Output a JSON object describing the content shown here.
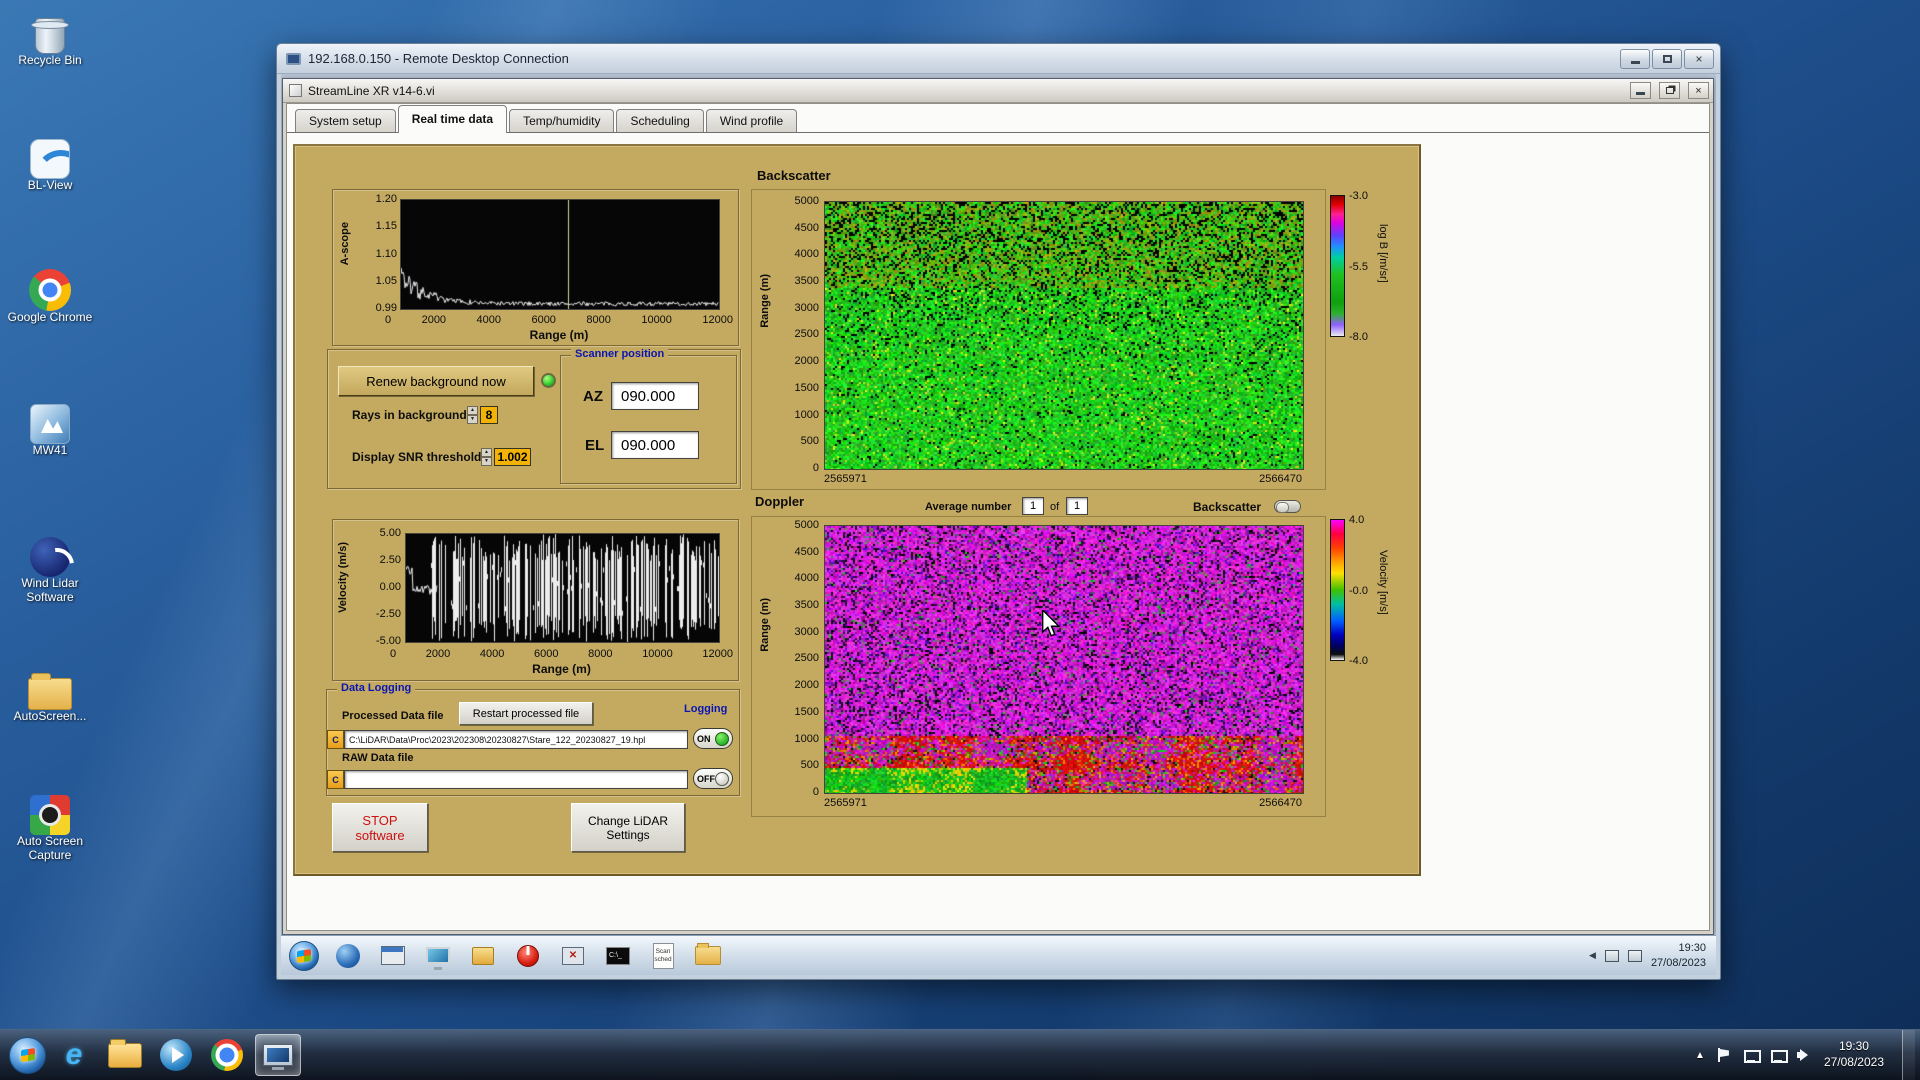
{
  "desktop": {
    "icons": [
      {
        "label": "Recycle Bin"
      },
      {
        "label": "BL-View"
      },
      {
        "label": "Google Chrome"
      },
      {
        "label": "MW41"
      },
      {
        "label": "Wind Lidar Software"
      },
      {
        "label": "AutoScreen..."
      },
      {
        "label": "Auto Screen Capture"
      }
    ]
  },
  "rdp_window": {
    "title": "192.168.0.150 - Remote Desktop Connection"
  },
  "app_window": {
    "title": "StreamLine XR v14-6.vi",
    "tabs": [
      "System setup",
      "Real time data",
      "Temp/humidity",
      "Scheduling",
      "Wind profile"
    ]
  },
  "controls": {
    "renew_button": "Renew background now",
    "rays_label": "Rays in background",
    "rays_value": "8",
    "snr_label": "Display SNR threshold",
    "snr_value": "1.002",
    "scanner": {
      "title": "Scanner position",
      "az_label": "AZ",
      "az_value": "090.000",
      "el_label": "EL",
      "el_value": "090.000"
    },
    "average_label": "Average number",
    "average_value": "1",
    "average_of": "of",
    "average_count": "1",
    "backscatter_toggle_label": "Backscatter"
  },
  "logging": {
    "group_title": "Data Logging",
    "processed_label": "Processed Data file",
    "restart_button": "Restart processed file",
    "logging_label": "Logging",
    "drive_label": "C",
    "processed_path": "C:\\LiDAR\\Data\\Proc\\2023\\202308\\20230827\\Stare_122_20230827_19.hpl",
    "raw_label": "RAW Data file",
    "raw_path": "",
    "on_label": "ON",
    "off_label": "OFF"
  },
  "actions": {
    "stop_line1": "STOP",
    "stop_line2": "software",
    "change_line1": "Change LiDAR",
    "change_line2": "Settings"
  },
  "session_taskbar": {
    "scan_icon_label": "Scan sched",
    "clock_time": "19:30",
    "clock_date": "27/08/2023"
  },
  "host_taskbar": {
    "clock_time": "19:30",
    "clock_date": "27/08/2023"
  },
  "chart_data": [
    {
      "id": "ascope",
      "type": "line",
      "xlabel": "Range (m)",
      "ylabel": "A-scope",
      "xlim": [
        0,
        12000
      ],
      "ylim": [
        0.99,
        1.2
      ],
      "xticks": [
        "0",
        "2000",
        "4000",
        "6000",
        "8000",
        "10000",
        "12000"
      ],
      "yticks": [
        "1.20",
        "1.15",
        "1.10",
        "1.05",
        "0.99"
      ],
      "cursor_x": 6300,
      "series": [
        {
          "name": "a-scope background",
          "x": [
            0,
            200,
            400,
            800,
            1200,
            2000,
            3000,
            4000,
            6000,
            8000,
            10000,
            12000
          ],
          "y": [
            1.005,
            1.06,
            1.05,
            1.035,
            1.02,
            1.01,
            1.005,
            1.002,
            1.0,
            1.0,
            1.0,
            1.0
          ]
        }
      ]
    },
    {
      "id": "backscatter",
      "type": "heatmap",
      "title": "Backscatter",
      "ylabel": "Range (m)",
      "ylim": [
        0,
        5000
      ],
      "yticks": [
        "5000",
        "4500",
        "4000",
        "3500",
        "3000",
        "2500",
        "2000",
        "1500",
        "1000",
        "500",
        "0"
      ],
      "x_start_label": "2565971",
      "x_end_label": "2566470",
      "colorbar": {
        "label": "log B [/m/sr]",
        "ticks": [
          "-3.0",
          "-5.5",
          "-8.0"
        ],
        "range": [
          -3.0,
          -8.0
        ]
      }
    },
    {
      "id": "velocity",
      "type": "bar",
      "xlabel": "Range (m)",
      "ylabel": "Velocity (m/s)",
      "xlim": [
        0,
        12000
      ],
      "ylim": [
        -5,
        5
      ],
      "xticks": [
        "0",
        "2000",
        "4000",
        "6000",
        "8000",
        "10000",
        "12000"
      ],
      "yticks": [
        "5.00",
        "2.50",
        "0.00",
        "-2.50",
        "-5.00"
      ]
    },
    {
      "id": "doppler",
      "type": "heatmap",
      "title": "Doppler",
      "ylabel": "Range (m)",
      "ylim": [
        0,
        5000
      ],
      "yticks": [
        "5000",
        "4500",
        "4000",
        "3500",
        "3000",
        "2500",
        "2000",
        "1500",
        "1000",
        "500",
        "0"
      ],
      "x_start_label": "2565971",
      "x_end_label": "2566470",
      "colorbar": {
        "label": "Velocity [m/s]",
        "ticks": [
          "4.0",
          "-0.0",
          "-4.0"
        ],
        "range": [
          4.0,
          -4.0
        ]
      }
    }
  ]
}
